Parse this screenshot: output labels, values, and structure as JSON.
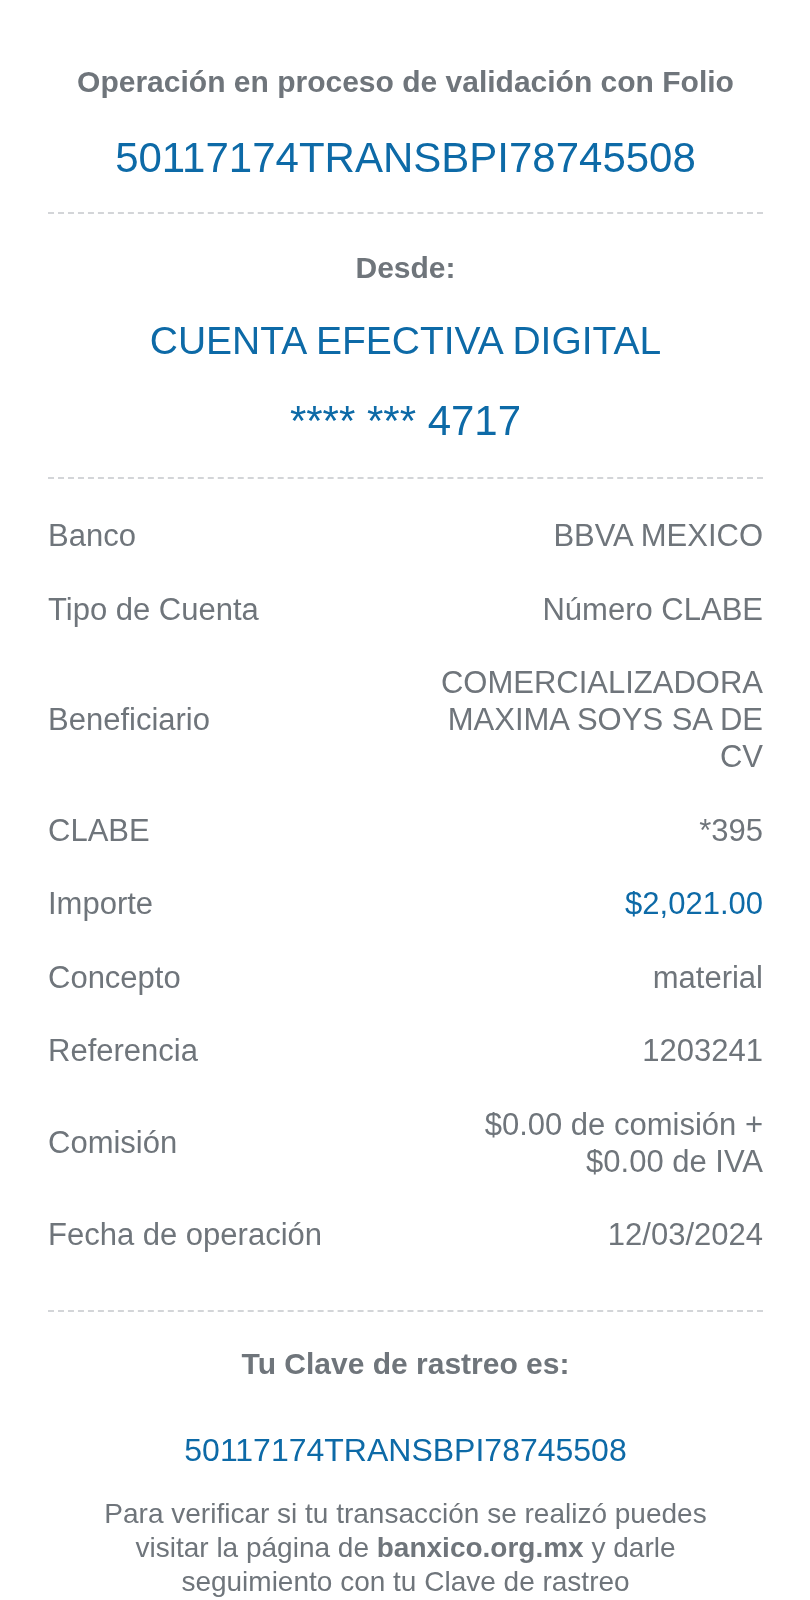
{
  "header": {
    "title": "Operación en proceso de validación con Folio",
    "folio": "50117174TRANSBPI78745508"
  },
  "origin": {
    "label": "Desde:",
    "account_name": "CUENTA EFECTIVA DIGITAL",
    "account_number": "**** *** 4717"
  },
  "details": [
    {
      "label": "Banco",
      "value": "BBVA MEXICO",
      "kind": "text"
    },
    {
      "label": "Tipo de Cuenta",
      "value": "Número CLABE",
      "kind": "text"
    },
    {
      "label": "Beneficiario",
      "value": "COMERCIALIZADORA MAXIMA SOYS SA DE CV",
      "kind": "text"
    },
    {
      "label": "CLABE",
      "value": "*395",
      "kind": "text"
    },
    {
      "label": "Importe",
      "value": "$2,021.00",
      "kind": "amount"
    },
    {
      "label": "Concepto",
      "value": "material",
      "kind": "text"
    },
    {
      "label": "Referencia",
      "value": "1203241",
      "kind": "text"
    },
    {
      "label": "Comisión",
      "value": "$0.00 de comisión + $0.00 de IVA",
      "kind": "text"
    },
    {
      "label": "Fecha de operación",
      "value": "12/03/2024",
      "kind": "text"
    }
  ],
  "tracking": {
    "label": "Tu Clave de rastreo es:",
    "code": "50117174TRANSBPI78745508",
    "note": "Para verificar si tu transacción se realizó puedes visitar la página de **banxico.org.mx** y darle seguimiento con tu Clave de rastreo"
  }
}
